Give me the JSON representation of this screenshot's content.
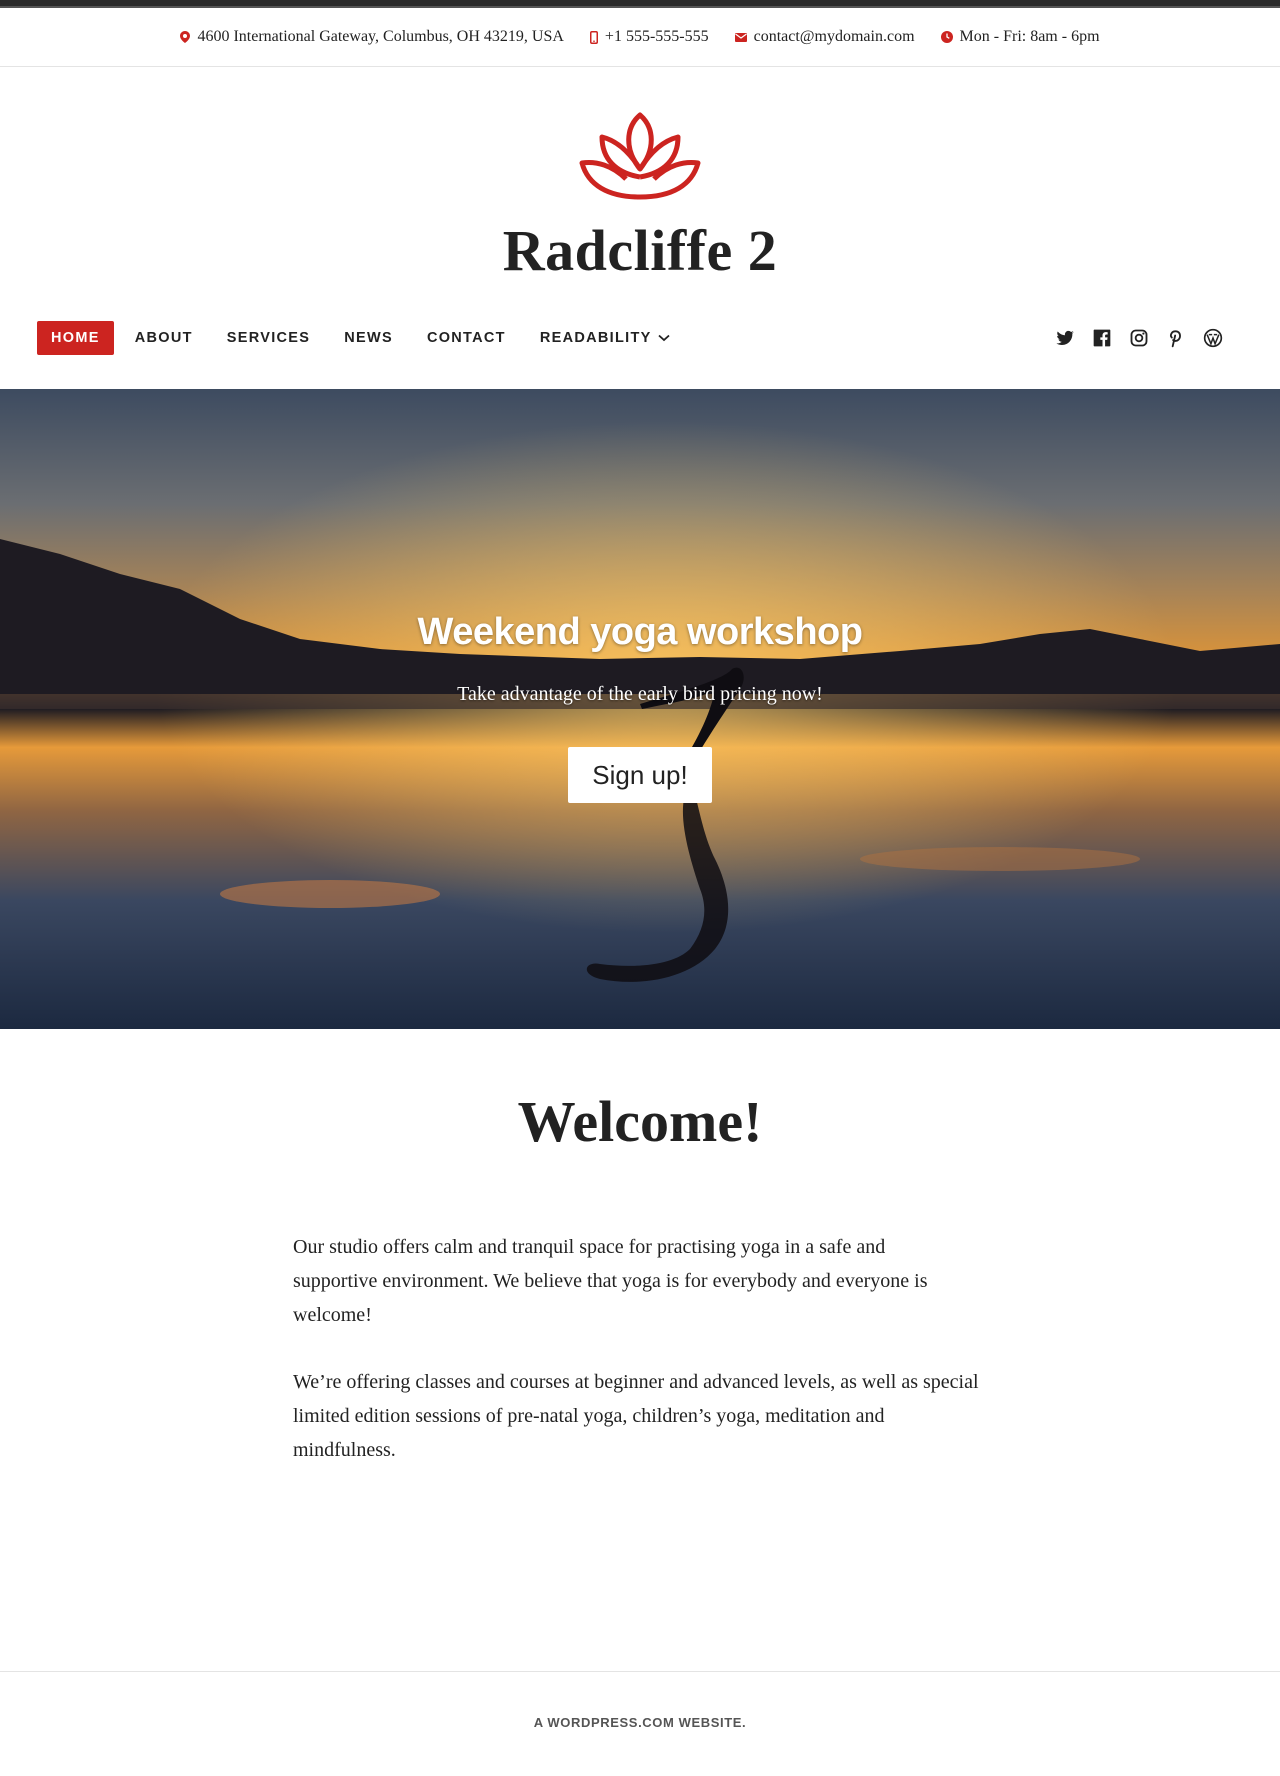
{
  "colors": {
    "accent": "#cc2420",
    "text": "#222222",
    "background": "#ffffff"
  },
  "info_bar": {
    "address": "4600 International Gateway, Columbus, OH 43219, USA",
    "phone": "+1 555-555-555",
    "email": "contact@mydomain.com",
    "hours": "Mon - Fri: 8am - 6pm",
    "icons": [
      "location-pin-icon",
      "phone-icon",
      "envelope-icon",
      "clock-icon"
    ]
  },
  "site": {
    "title": "Radcliffe 2",
    "logo": "lotus-logo"
  },
  "nav": {
    "items": [
      {
        "label": "HOME",
        "active": true
      },
      {
        "label": "ABOUT"
      },
      {
        "label": "SERVICES"
      },
      {
        "label": "NEWS"
      },
      {
        "label": "CONTACT"
      },
      {
        "label": "READABILITY",
        "dropdown": true
      }
    ],
    "social": [
      "twitter-icon",
      "facebook-icon",
      "instagram-icon",
      "pinterest-icon",
      "wordpress-icon"
    ]
  },
  "hero": {
    "title": "Weekend yoga workshop",
    "subtitle": "Take advantage of the early bird pricing now!",
    "button": "Sign up!"
  },
  "content": {
    "heading": "Welcome!",
    "paragraphs": [
      "Our studio offers calm and tranquil space for practising yoga in a safe and supportive environment. We believe that yoga is for everybody and everyone is welcome!",
      "We’re offering classes and courses at beginner and advanced levels, as well as special limited edition sessions of pre-natal yoga, children’s yoga, meditation and mindfulness."
    ]
  },
  "footer": {
    "text": "A WORDPRESS.COM WEBSITE."
  }
}
